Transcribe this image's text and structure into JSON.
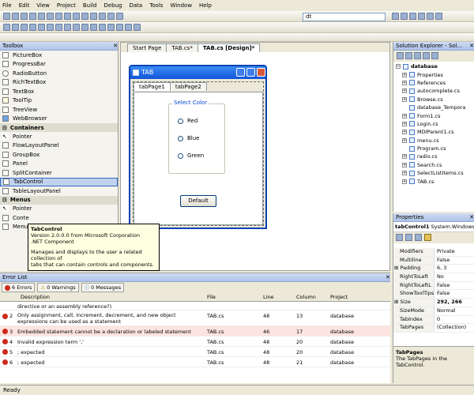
{
  "menu": [
    "File",
    "Edit",
    "View",
    "Project",
    "Build",
    "Debug",
    "Data",
    "Tools",
    "Window",
    "Help"
  ],
  "toolbar": {
    "search_value": "dt"
  },
  "toolbox": {
    "title": "Toolbox",
    "items_top": [
      "PictureBox",
      "ProgressBar",
      "RadioButton",
      "RichTextBox",
      "TextBox",
      "ToolTip",
      "TreeView",
      "WebBrowser"
    ],
    "containers_label": "Containers",
    "containers": [
      "Pointer",
      "FlowLayoutPanel",
      "GroupBox",
      "Panel",
      "SplitContainer",
      "TabControl",
      "TableLayoutPanel"
    ],
    "menus_label": "Menus",
    "menus_items": [
      "Pointer",
      "Conte",
      "Menu"
    ]
  },
  "tooltip": {
    "title": "TabControl",
    "version": "Version 2.0.0.0 from Microsoft Corporation",
    "kind": ".NET Component",
    "desc1": "Manages and displays to the user a related collection of",
    "desc2": "tabs that can contain controls and components."
  },
  "document": {
    "tabs": [
      "Start Page",
      "TAB.cs*",
      "TAB.cs [Design]*"
    ],
    "form_title": "TAB",
    "tab_pages": [
      "tabPage1",
      "tabPage2"
    ],
    "group_label": "Select Color",
    "radios": [
      "Red",
      "Blue",
      "Green"
    ],
    "button_label": "Default"
  },
  "solution_explorer": {
    "title": "Solution Explorer - Sol...",
    "project": "database",
    "items": [
      "Properties",
      "References",
      "autocomplete.cs",
      "Browse.cs",
      "database_Tempora",
      "Form1.cs",
      "Login.cs",
      "MDIParent1.cs",
      "menu.cs",
      "Program.cs",
      "radio.cs",
      "Search.cs",
      "SelectListItems.cs",
      "TAB.cs"
    ]
  },
  "properties": {
    "title": "Properties",
    "object": "tabControl1",
    "object_type": "System.Windows.",
    "rows": [
      {
        "name": "Modifiers",
        "value": "Private"
      },
      {
        "name": "Multiline",
        "value": "False"
      },
      {
        "name": "Padding",
        "value": "6, 3"
      },
      {
        "name": "RightToLeft",
        "value": "No"
      },
      {
        "name": "RightToLeftL",
        "value": "False"
      },
      {
        "name": "ShowToolTips",
        "value": "False"
      },
      {
        "name": "Size",
        "value": "292, 266"
      },
      {
        "name": "SizeMode",
        "value": "Normal"
      },
      {
        "name": "TabIndex",
        "value": "0"
      },
      {
        "name": "TabPages",
        "value": "(Collection)"
      }
    ],
    "desc_title": "TabPages",
    "desc_text": "The TabPages in the TabControl."
  },
  "error_list": {
    "title": "Error List",
    "errors_btn": "6 Errors",
    "warnings_btn": "0 Warnings",
    "messages_btn": "0 Messages",
    "headers": {
      "description": "Description",
      "file": "File",
      "line": "Line",
      "column": "Column",
      "project": "Project"
    },
    "partial_row": "directive or an assembly reference?)",
    "rows": [
      {
        "num": "2",
        "desc": "Only assignment, call, increment, decrement, and new object expressions can be used as a statement",
        "file": "TAB.cs",
        "line": "48",
        "col": "13",
        "proj": "database"
      },
      {
        "num": "3",
        "desc": "Embedded statement cannot be a declaration or labeled statement",
        "file": "TAB.cs",
        "line": "46",
        "col": "17",
        "proj": "database"
      },
      {
        "num": "4",
        "desc": "Invalid expression term ','",
        "file": "TAB.cs",
        "line": "48",
        "col": "20",
        "proj": "database"
      },
      {
        "num": "5",
        "desc": "; expected",
        "file": "TAB.cs",
        "line": "48",
        "col": "20",
        "proj": "database"
      },
      {
        "num": "6",
        "desc": "; expected",
        "file": "TAB.cs",
        "line": "48",
        "col": "21",
        "proj": "database"
      }
    ]
  },
  "status": "Ready"
}
